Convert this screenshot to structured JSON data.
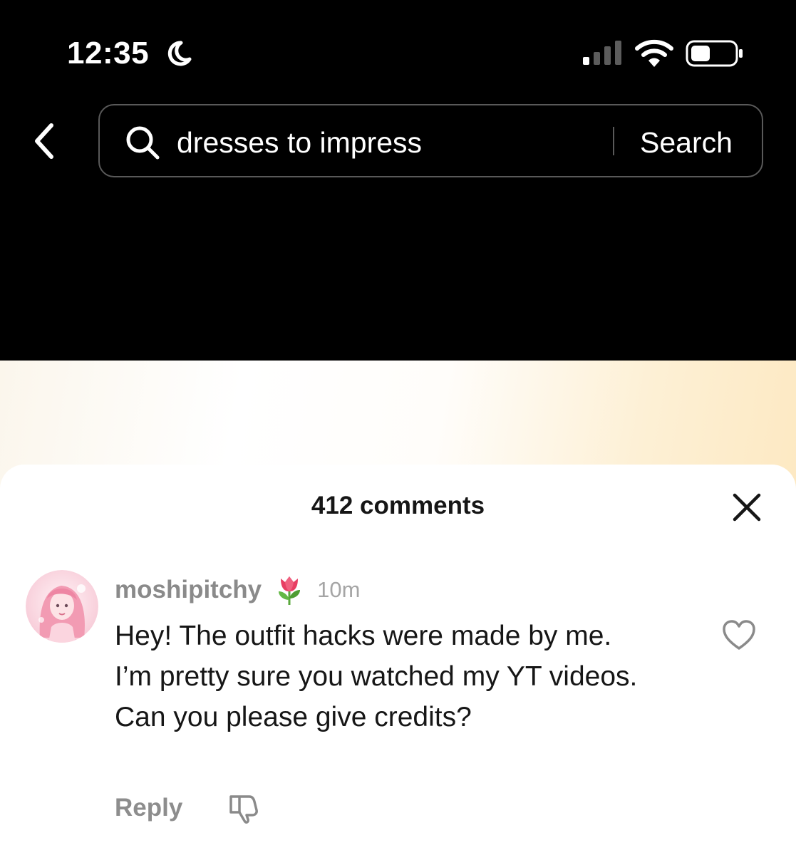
{
  "status_bar": {
    "time": "12:35",
    "icons": [
      "moon-icon",
      "signal-icon",
      "wifi-icon",
      "battery-icon"
    ]
  },
  "search": {
    "query": "dresses to impress",
    "button_label": "Search"
  },
  "comments": {
    "count_label": "412 comments",
    "items": [
      {
        "username": "moshipitchy",
        "badge_icon": "tulip-icon",
        "time_ago": "10m",
        "text": "Hey! The outfit hacks were made by me. I’m pretty sure you watched my YT videos. Can you please give credits?",
        "reply_label": "Reply"
      }
    ]
  },
  "colors": {
    "header_bg": "#000000",
    "sheet_bg": "#ffffff",
    "primary_text": "#161616",
    "secondary_text": "#8a8a8a",
    "avatar_pink": "#f6b6c8"
  }
}
